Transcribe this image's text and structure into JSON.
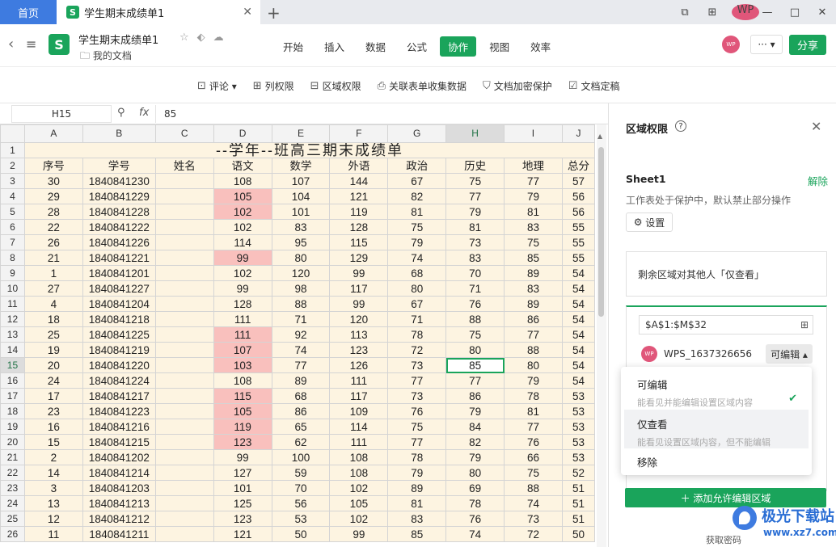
{
  "tabs": {
    "home": "首页",
    "doc": "学生期末成绩单1"
  },
  "header": {
    "title": "学生期末成绩单1",
    "folder": "我的文档",
    "avatar": "WP",
    "more": "··· ▾",
    "share": "分享",
    "menus": [
      "开始",
      "插入",
      "数据",
      "公式",
      "协作",
      "视图",
      "效率"
    ],
    "active_menu": "协作"
  },
  "toolbar": [
    {
      "icon": "comment-icon",
      "glyph": "⊡",
      "label": "评论 ▾"
    },
    {
      "icon": "column-perm-icon",
      "glyph": "⊞",
      "label": "列权限"
    },
    {
      "icon": "region-perm-icon",
      "glyph": "⊟",
      "label": "区域权限"
    },
    {
      "icon": "collect-icon",
      "glyph": "⎙",
      "label": "关联表单收集数据"
    },
    {
      "icon": "shield-icon",
      "glyph": "⛉",
      "label": "文档加密保护"
    },
    {
      "icon": "lock-icon",
      "glyph": "☑",
      "label": "文档定稿"
    }
  ],
  "formula_bar": {
    "cell_ref": "H15",
    "value": "85",
    "fx": "fx"
  },
  "sheet": {
    "columns": [
      "A",
      "B",
      "C",
      "D",
      "E",
      "F",
      "G",
      "H",
      "I",
      "J"
    ],
    "title": "--学年--班高三期末成绩单",
    "headers": [
      "序号",
      "学号",
      "姓名",
      "语文",
      "数学",
      "外语",
      "政治",
      "历史",
      "地理",
      "总分"
    ],
    "rows": [
      [
        "30",
        "1840841230",
        "",
        "108",
        "107",
        "144",
        "67",
        "75",
        "77",
        "57"
      ],
      [
        "29",
        "1840841229",
        "",
        "105",
        "104",
        "121",
        "82",
        "77",
        "79",
        "56"
      ],
      [
        "28",
        "1840841228",
        "",
        "102",
        "101",
        "119",
        "81",
        "79",
        "81",
        "56"
      ],
      [
        "22",
        "1840841222",
        "",
        "102",
        "83",
        "128",
        "75",
        "81",
        "83",
        "55"
      ],
      [
        "26",
        "1840841226",
        "",
        "114",
        "95",
        "115",
        "79",
        "73",
        "75",
        "55"
      ],
      [
        "21",
        "1840841221",
        "",
        "99",
        "80",
        "129",
        "74",
        "83",
        "85",
        "55"
      ],
      [
        "1",
        "1840841201",
        "",
        "102",
        "120",
        "99",
        "68",
        "70",
        "89",
        "54"
      ],
      [
        "27",
        "1840841227",
        "",
        "99",
        "98",
        "117",
        "80",
        "71",
        "83",
        "54"
      ],
      [
        "4",
        "1840841204",
        "",
        "128",
        "88",
        "99",
        "67",
        "76",
        "89",
        "54"
      ],
      [
        "18",
        "1840841218",
        "",
        "111",
        "71",
        "120",
        "71",
        "88",
        "86",
        "54"
      ],
      [
        "25",
        "1840841225",
        "",
        "111",
        "92",
        "113",
        "78",
        "75",
        "77",
        "54"
      ],
      [
        "19",
        "1840841219",
        "",
        "107",
        "74",
        "123",
        "72",
        "80",
        "88",
        "54"
      ],
      [
        "20",
        "1840841220",
        "",
        "103",
        "77",
        "126",
        "73",
        "85",
        "80",
        "54"
      ],
      [
        "24",
        "1840841224",
        "",
        "108",
        "89",
        "111",
        "77",
        "77",
        "79",
        "54"
      ],
      [
        "17",
        "1840841217",
        "",
        "115",
        "68",
        "117",
        "73",
        "86",
        "78",
        "53"
      ],
      [
        "23",
        "1840841223",
        "",
        "105",
        "86",
        "109",
        "76",
        "79",
        "81",
        "53"
      ],
      [
        "16",
        "1840841216",
        "",
        "119",
        "65",
        "114",
        "75",
        "84",
        "77",
        "53"
      ],
      [
        "15",
        "1840841215",
        "",
        "123",
        "62",
        "111",
        "77",
        "82",
        "76",
        "53"
      ],
      [
        "2",
        "1840841202",
        "",
        "99",
        "100",
        "108",
        "78",
        "79",
        "66",
        "53"
      ],
      [
        "14",
        "1840841214",
        "",
        "127",
        "59",
        "108",
        "79",
        "80",
        "75",
        "52"
      ],
      [
        "3",
        "1840841203",
        "",
        "101",
        "70",
        "102",
        "89",
        "69",
        "88",
        "51"
      ],
      [
        "13",
        "1840841213",
        "",
        "125",
        "56",
        "105",
        "81",
        "78",
        "74",
        "51"
      ],
      [
        "12",
        "1840841212",
        "",
        "123",
        "53",
        "102",
        "83",
        "76",
        "73",
        "51"
      ],
      [
        "11",
        "1840841211",
        "",
        "121",
        "50",
        "99",
        "85",
        "74",
        "72",
        "50"
      ]
    ],
    "highlighted_rows_col_d": [
      1,
      2,
      5,
      10,
      11,
      12,
      14,
      15,
      16,
      17
    ],
    "current_cell_row": 15,
    "highlight_color": "#f9c0bd",
    "fill_color": "#fdf4e1"
  },
  "panel": {
    "title": "区域权限",
    "sheet_name": "Sheet1",
    "unlock": "解除",
    "desc": "工作表处于保护中，默认禁止部分操作",
    "settings": "设置",
    "rest_text": "剩余区域对其他人「仅查看」",
    "range": "$A$1:$M$32",
    "user_avatar": "WP",
    "user": "WPS_1637326656",
    "perm": "可编辑 ▴",
    "add_button": "＋  添加允许编辑区域"
  },
  "dropdown": [
    {
      "title": "可编辑",
      "sub": "能看见并能编辑设置区域内容",
      "checked": true
    },
    {
      "title": "仅查看",
      "sub": "能看见设置区域内容，但不能编辑",
      "checked": false
    },
    {
      "title": "移除",
      "sub": "",
      "checked": false
    }
  ],
  "watermark": {
    "brand": "极光下载站",
    "url": "www.xz7.com",
    "fetch": "获取密码"
  },
  "accent": "#1aa45b"
}
